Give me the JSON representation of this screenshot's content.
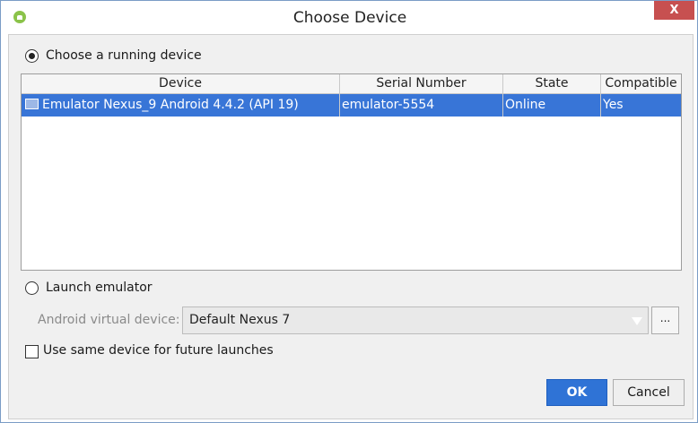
{
  "window": {
    "title": "Choose Device",
    "close_label": "X"
  },
  "running": {
    "label": "Choose a running device"
  },
  "table": {
    "headers": {
      "device": "Device",
      "serial": "Serial Number",
      "state": "State",
      "compatible": "Compatible"
    },
    "rows": [
      {
        "device": "Emulator Nexus_9 Android 4.4.2 (API 19)",
        "serial": "emulator-5554",
        "state": "Online",
        "compatible": "Yes"
      }
    ]
  },
  "launch": {
    "label": "Launch emulator",
    "avd_label": "Android virtual device:",
    "avd_value": "Default Nexus 7",
    "browse_label": "..."
  },
  "same_device": {
    "label": "Use same device for future launches"
  },
  "buttons": {
    "ok": "OK",
    "cancel": "Cancel"
  }
}
